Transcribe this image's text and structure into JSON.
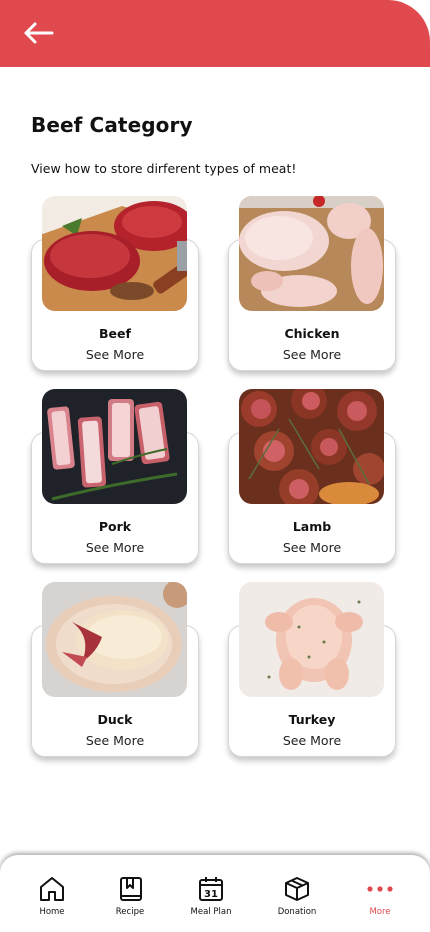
{
  "header": {
    "back_icon": "arrow-left-icon",
    "color": "#e04a4f"
  },
  "page": {
    "title": "Beef Category",
    "subtitle": "View how to store dirferent types of meat!"
  },
  "categories": [
    {
      "name": "Beef",
      "action": "See More",
      "image": "beef-photo"
    },
    {
      "name": "Chicken",
      "action": "See More",
      "image": "chicken-photo"
    },
    {
      "name": "Pork",
      "action": "See More",
      "image": "pork-photo"
    },
    {
      "name": "Lamb",
      "action": "See More",
      "image": "lamb-photo"
    },
    {
      "name": "Duck",
      "action": "See More",
      "image": "duck-photo"
    },
    {
      "name": "Turkey",
      "action": "See More",
      "image": "turkey-photo"
    }
  ],
  "nav": {
    "items": [
      {
        "label": "Home",
        "icon": "home-icon"
      },
      {
        "label": "Recipe",
        "icon": "book-icon"
      },
      {
        "label": "Meal Plan",
        "icon": "calendar-icon"
      },
      {
        "label": "Donation",
        "icon": "box-icon"
      },
      {
        "label": "More",
        "icon": "more-dots-icon",
        "active": true
      }
    ],
    "calendar_day": "31",
    "active_color": "#e04a4f"
  }
}
